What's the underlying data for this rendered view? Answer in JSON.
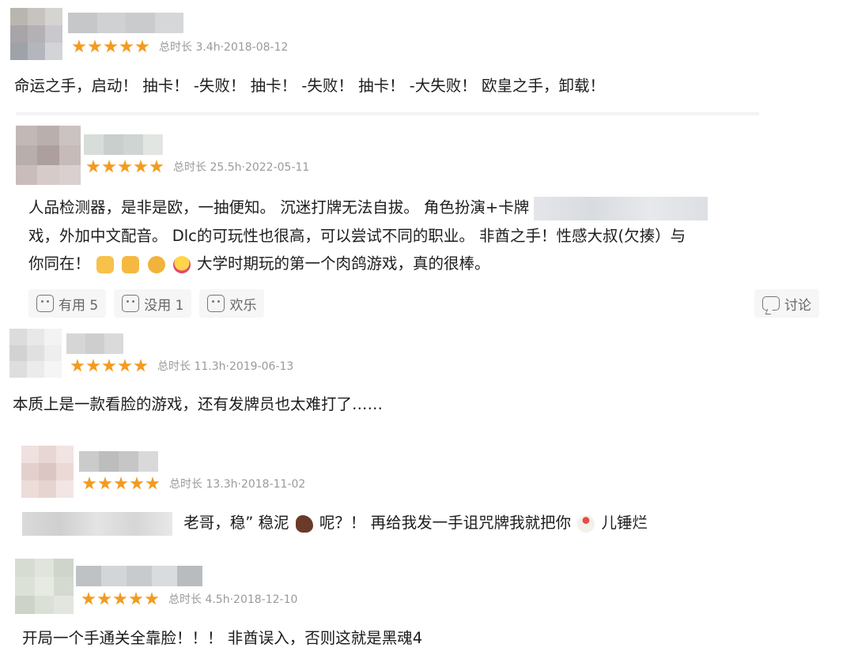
{
  "reviews": [
    {
      "id": "r1",
      "stars": 5,
      "playtime": "总时长 3.4h·2018-08-12",
      "text": "命运之手，启动！ 抽卡！ -失败！ 抽卡！ -失败！ 抽卡！ -大失败！ 欧皇之手，卸载！"
    },
    {
      "id": "r2",
      "stars": 5,
      "playtime": "总时长 25.5h·2022-05-11",
      "line1": "人品检测器，是非是欧，一抽便知。 沉迷打牌无法自拔。 角色扮演+卡牌",
      "line2": "戏，外加中文配音。 Dlc的可玩性也很高，可以尝试不同的职业。 非酋之手！性感大叔(欠揍）与",
      "line3_a": "你同在！",
      "line3_b": "大学时期玩的第一个肉鸽游戏，真的很棒。",
      "actions": {
        "useful": "有用 5",
        "useless": "没用 1",
        "fun": "欢乐",
        "discuss": "讨论"
      }
    },
    {
      "id": "r3",
      "stars": 5,
      "playtime": "总时长 11.3h·2019-06-13",
      "text": "本质上是一款看脸的游戏，还有发牌员也太难打了……"
    },
    {
      "id": "r4",
      "stars": 5,
      "playtime": "总时长 13.3h·2018-11-02",
      "text_a": "老哥，稳” 稳泥",
      "text_b": "呢？！ 再给我发一手诅咒牌我就把你",
      "text_c": "儿锤烂"
    },
    {
      "id": "r5",
      "stars": 5,
      "playtime": "总时长 4.5h·2018-12-10",
      "text": "开局一个手通关全靠脸！！！ 非酋误入，否则这就是黑魂4"
    }
  ],
  "colors": {
    "star": "#f39b1e",
    "meta_text": "#9a9a9a",
    "action_bg": "#f6f6f6"
  },
  "icons": {
    "useful": "thumb-face-icon",
    "useless": "neutral-face-icon",
    "fun": "laugh-face-icon",
    "discuss": "chat-bubble-icon"
  }
}
